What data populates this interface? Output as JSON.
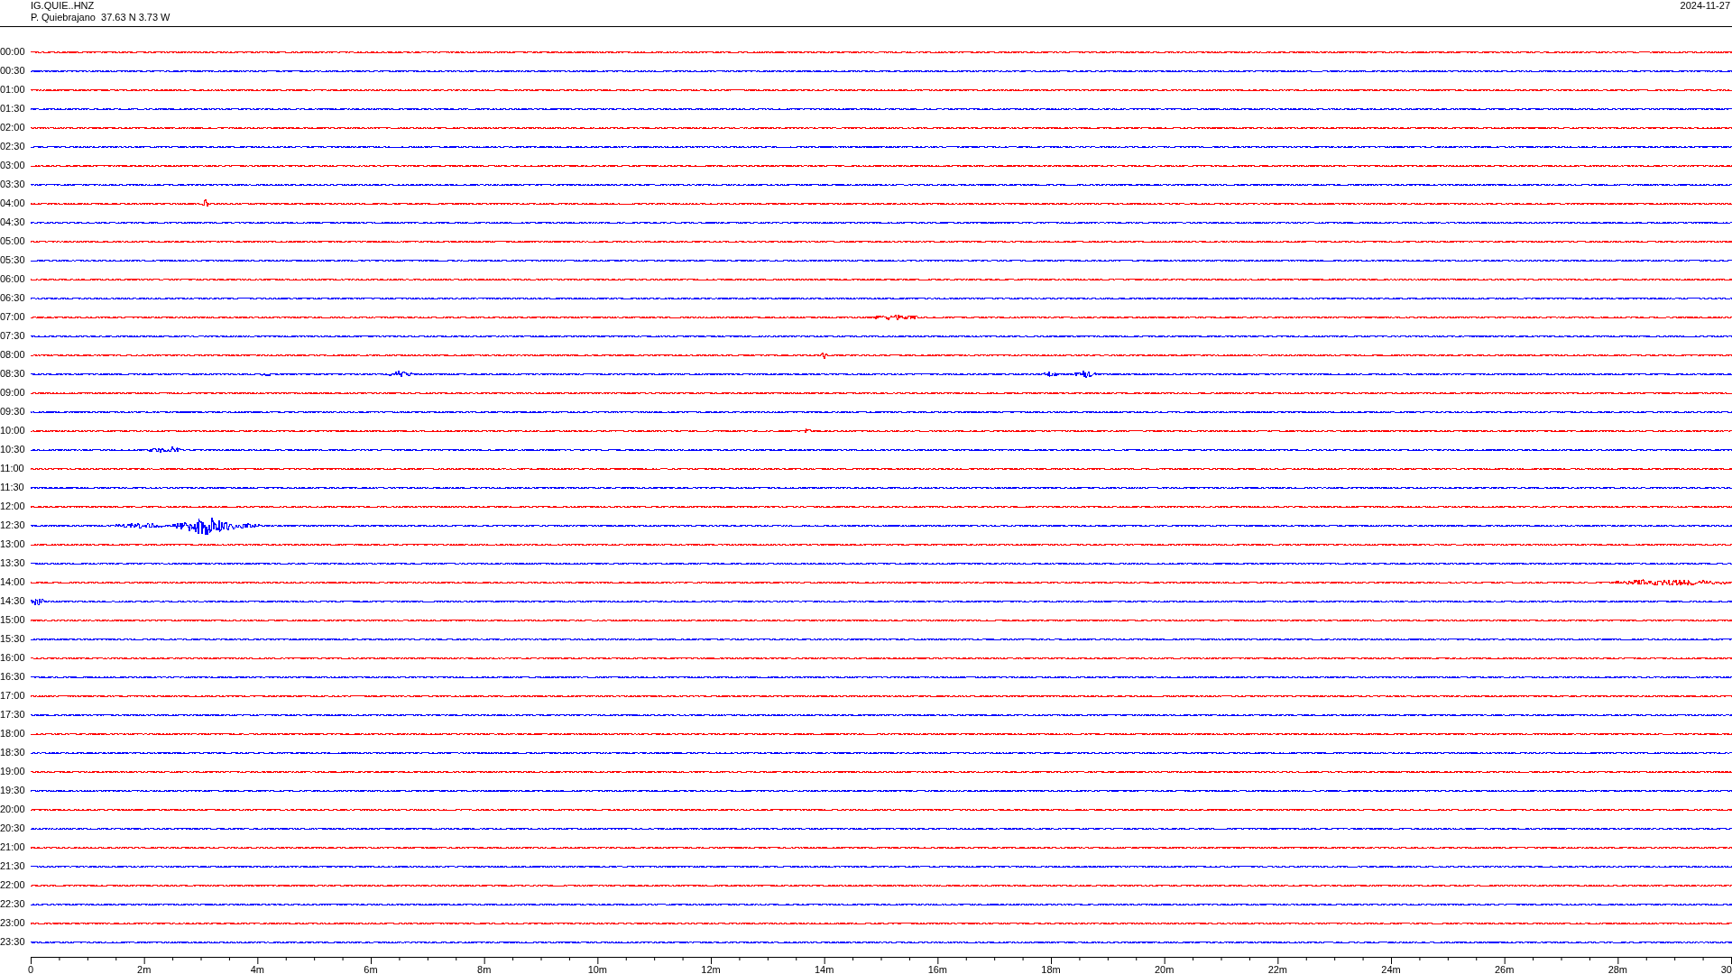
{
  "header": {
    "channel": "IG.QUIE..HNZ",
    "station": "P. Quiebrajano  37.63 N 3.73 W",
    "date": "2024-11-27"
  },
  "rows": [
    {
      "time": "00:00",
      "color": "#ff0000"
    },
    {
      "time": "00:30",
      "color": "#0000ff"
    },
    {
      "time": "01:00",
      "color": "#ff0000"
    },
    {
      "time": "01:30",
      "color": "#0000ff"
    },
    {
      "time": "02:00",
      "color": "#ff0000"
    },
    {
      "time": "02:30",
      "color": "#0000ff"
    },
    {
      "time": "03:00",
      "color": "#ff0000"
    },
    {
      "time": "03:30",
      "color": "#0000ff"
    },
    {
      "time": "04:00",
      "color": "#ff0000"
    },
    {
      "time": "04:30",
      "color": "#0000ff"
    },
    {
      "time": "05:00",
      "color": "#ff0000"
    },
    {
      "time": "05:30",
      "color": "#0000ff"
    },
    {
      "time": "06:00",
      "color": "#ff0000"
    },
    {
      "time": "06:30",
      "color": "#0000ff"
    },
    {
      "time": "07:00",
      "color": "#ff0000"
    },
    {
      "time": "07:30",
      "color": "#0000ff"
    },
    {
      "time": "08:00",
      "color": "#ff0000"
    },
    {
      "time": "08:30",
      "color": "#0000ff"
    },
    {
      "time": "09:00",
      "color": "#ff0000"
    },
    {
      "time": "09:30",
      "color": "#0000ff"
    },
    {
      "time": "10:00",
      "color": "#ff0000"
    },
    {
      "time": "10:30",
      "color": "#0000ff"
    },
    {
      "time": "11:00",
      "color": "#ff0000"
    },
    {
      "time": "11:30",
      "color": "#0000ff"
    },
    {
      "time": "12:00",
      "color": "#ff0000"
    },
    {
      "time": "12:30",
      "color": "#0000ff"
    },
    {
      "time": "13:00",
      "color": "#ff0000"
    },
    {
      "time": "13:30",
      "color": "#0000ff"
    },
    {
      "time": "14:00",
      "color": "#ff0000"
    },
    {
      "time": "14:30",
      "color": "#0000ff"
    },
    {
      "time": "15:00",
      "color": "#ff0000"
    },
    {
      "time": "15:30",
      "color": "#0000ff"
    },
    {
      "time": "16:00",
      "color": "#ff0000"
    },
    {
      "time": "16:30",
      "color": "#0000ff"
    },
    {
      "time": "17:00",
      "color": "#ff0000"
    },
    {
      "time": "17:30",
      "color": "#0000ff"
    },
    {
      "time": "18:00",
      "color": "#ff0000"
    },
    {
      "time": "18:30",
      "color": "#0000ff"
    },
    {
      "time": "19:00",
      "color": "#ff0000"
    },
    {
      "time": "19:30",
      "color": "#0000ff"
    },
    {
      "time": "20:00",
      "color": "#ff0000"
    },
    {
      "time": "20:30",
      "color": "#0000ff"
    },
    {
      "time": "21:00",
      "color": "#ff0000"
    },
    {
      "time": "21:30",
      "color": "#0000ff"
    },
    {
      "time": "22:00",
      "color": "#ff0000"
    },
    {
      "time": "22:30",
      "color": "#0000ff"
    },
    {
      "time": "23:00",
      "color": "#ff0000"
    },
    {
      "time": "23:30",
      "color": "#0000ff"
    }
  ],
  "x_axis": {
    "ticks": [
      "0",
      "2m",
      "4m",
      "6m",
      "8m",
      "10m",
      "12m",
      "14m",
      "16m",
      "18m",
      "20m",
      "22m",
      "24m",
      "26m",
      "28m",
      "30"
    ]
  }
}
